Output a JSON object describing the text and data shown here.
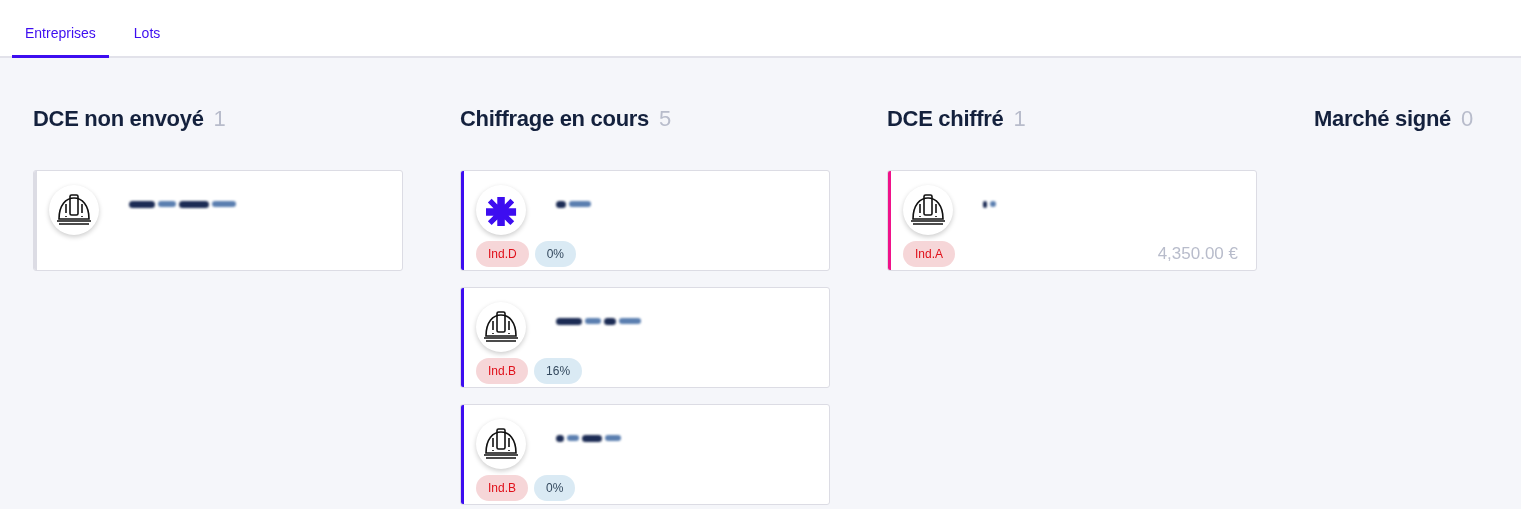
{
  "tabs": [
    {
      "label": "Entreprises",
      "selected": true
    },
    {
      "label": "Lots",
      "selected": false
    }
  ],
  "columns": [
    {
      "title": "DCE non envoyé",
      "count": "1",
      "cards": [
        {
          "kind": "helmet",
          "color": "#dcdce4"
        }
      ]
    },
    {
      "title": "Chiffrage en cours",
      "count": "5",
      "cards": [
        {
          "kind": "asterisk",
          "color": "#3d0df0",
          "tags": [
            {
              "kind": "index",
              "label": "Ind.D"
            },
            {
              "kind": "progress",
              "label": "0%"
            }
          ]
        },
        {
          "kind": "helmet",
          "color": "#3d0df0",
          "tags": [
            {
              "kind": "index",
              "label": "Ind.B"
            },
            {
              "kind": "progress",
              "label": "16%"
            }
          ]
        },
        {
          "kind": "helmet",
          "color": "#3d0df0",
          "tags": [
            {
              "kind": "index",
              "label": "Ind.B"
            },
            {
              "kind": "progress",
              "label": "0%"
            }
          ]
        }
      ]
    },
    {
      "title": "DCE chiffré",
      "count": "1",
      "cards": [
        {
          "kind": "helmet",
          "color": "#f0128a",
          "tags": [
            {
              "kind": "index",
              "label": "Ind.A"
            }
          ],
          "amount": "4,350.00 €"
        }
      ]
    },
    {
      "title": "Marché signé",
      "count": "0"
    }
  ]
}
